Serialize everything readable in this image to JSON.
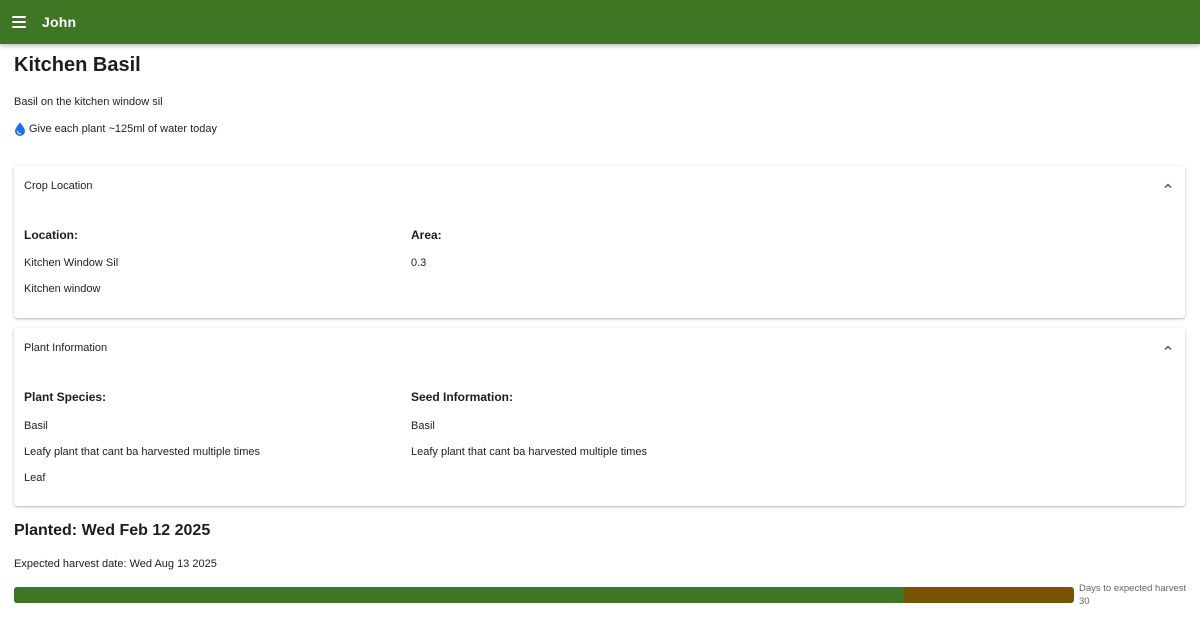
{
  "appbar": {
    "title": "John",
    "color": "#3f7624"
  },
  "crop": {
    "name": "Kitchen Basil",
    "description": "Basil on the kitchen window sil",
    "water_tip": "Give each plant ~125ml of water today",
    "water_icon": "water-drop-icon"
  },
  "location_card": {
    "header": "Crop Location",
    "location_heading": "Location:",
    "location_name": "Kitchen Window Sil",
    "location_description": "Kitchen window",
    "area_heading": "Area:",
    "area_value": "0.3"
  },
  "plant_card": {
    "header": "Plant Information",
    "species_heading": "Plant Species:",
    "species_name": "Basil",
    "species_description": "Leafy plant that cant ba harvested multiple times",
    "species_type": "Leaf",
    "seed_heading": "Seed Information:",
    "seed_name": "Basil",
    "seed_description": "Leafy plant that cant ba harvested multiple times"
  },
  "timeline": {
    "planted": "Planted: Wed Feb 12 2025",
    "expected_harvest": "Expected harvest date: Wed Aug 13 2025",
    "progress_fraction": 0.84,
    "days_label": "Days to expected harvest",
    "days_value": "30",
    "elapsed_color": "#3f7624",
    "remaining_color": "#7a5307"
  }
}
